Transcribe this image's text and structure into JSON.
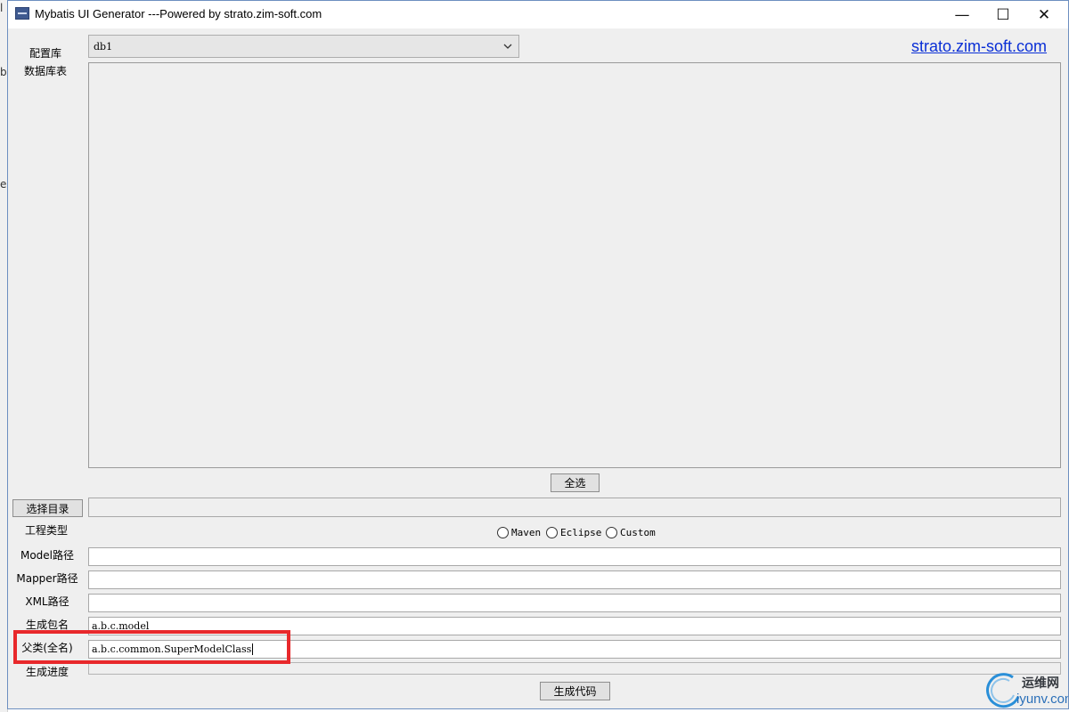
{
  "background_window": {
    "letters": [
      "l",
      "b",
      "e"
    ]
  },
  "window": {
    "title": "Mybatis UI Generator ---Powered by strato.zim-soft.com",
    "min_glyph": "—",
    "max_glyph": "☐",
    "close_glyph": "✕"
  },
  "config": {
    "label": "配置库",
    "selected": "db1",
    "link": "strato.zim-soft.com"
  },
  "tables": {
    "label": "数据库表"
  },
  "select_all_label": "全选",
  "choose_dir_label": "选择目录",
  "project_type": {
    "label": "工程类型",
    "options": [
      "Maven",
      "Eclipse",
      "Custom"
    ]
  },
  "fields": {
    "model_path": {
      "label": "Model路径",
      "value": ""
    },
    "mapper_path": {
      "label": "Mapper路径",
      "value": ""
    },
    "xml_path": {
      "label": "XML路径",
      "value": ""
    },
    "package": {
      "label": "生成包名",
      "value": "a.b.c.model"
    },
    "parent_class": {
      "label": "父类(全名)",
      "value": "a.b.c.common.SuperModelClass"
    }
  },
  "progress": {
    "label": "生成进度"
  },
  "generate_label": "生成代码",
  "watermark": {
    "cn": "运维网",
    "domain": "iyunv.com"
  },
  "colors": {
    "highlight": "#e8282b",
    "link": "#0a2fd6"
  }
}
